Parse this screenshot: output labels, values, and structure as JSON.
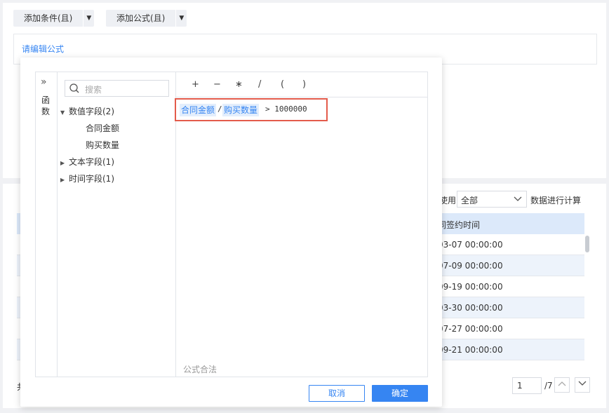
{
  "toolbar": {
    "add_condition": "添加条件(且)",
    "add_formula": "添加公式(且)",
    "formula_placeholder": "请编辑公式"
  },
  "calc": {
    "use_prefix": "使用",
    "scope_value": "全部",
    "suffix": "数据进行计算"
  },
  "table": {
    "header_right": "同签约时间",
    "rows": [
      "03-07 00:00:00",
      "07-09 00:00:00",
      "09-19 00:00:00",
      "03-30 00:00:00",
      "07-27 00:00:00",
      "09-21 00:00:00"
    ]
  },
  "pager": {
    "left_text": "共",
    "current": "1",
    "total": "/7"
  },
  "dialog": {
    "functions_label": "函数",
    "search_placeholder": "搜索",
    "tree": {
      "numeric_group": "数值字段(2)",
      "numeric_items": [
        "合同金额",
        "购买数量"
      ],
      "text_group": "文本字段(1)",
      "time_group": "时间字段(1)"
    },
    "operators": [
      "+",
      "−",
      "∗",
      "/",
      "(",
      ")"
    ],
    "formula": {
      "field1": "合同金额",
      "op1": "/",
      "field2": "购买数量",
      "rest": "> 1000000"
    },
    "status": "公式合法",
    "cancel": "取消",
    "confirm": "确定"
  },
  "colors": {
    "accent": "#3685f2",
    "highlight_border": "#e35b4b"
  }
}
